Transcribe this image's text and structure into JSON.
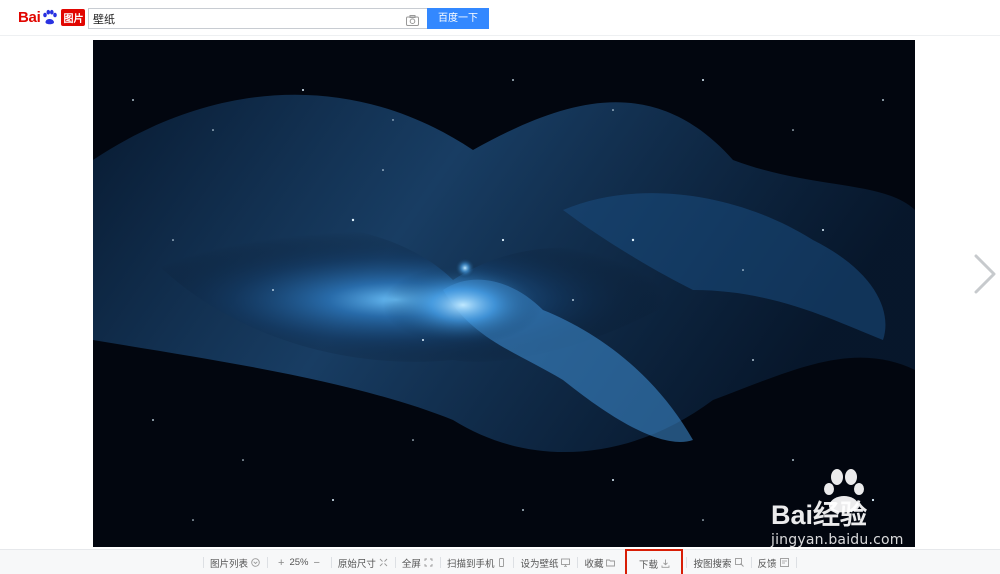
{
  "header": {
    "logo": {
      "bai": "Bai",
      "du": "du",
      "tupian": "图片"
    },
    "search": {
      "value": "壁纸"
    },
    "search_button": "百度一下"
  },
  "toolbar": {
    "image_list": "图片列表",
    "zoom_in": "+",
    "zoom_level": "25%",
    "zoom_out": "−",
    "original_size": "原始尺寸",
    "fullscreen": "全屏",
    "scan_to_phone": "扫描到手机",
    "set_wallpaper": "设为壁纸",
    "favorite": "收藏",
    "download": "下载",
    "search_by_image": "按图搜索",
    "feedback": "反馈"
  },
  "watermark": {
    "brand": "Bai经验",
    "url": "jingyan.baidu.com"
  },
  "colors": {
    "brand_red": "#e10601",
    "brand_blue": "#2932e1",
    "button_blue": "#3388ff",
    "highlight_border": "#d81e06"
  }
}
